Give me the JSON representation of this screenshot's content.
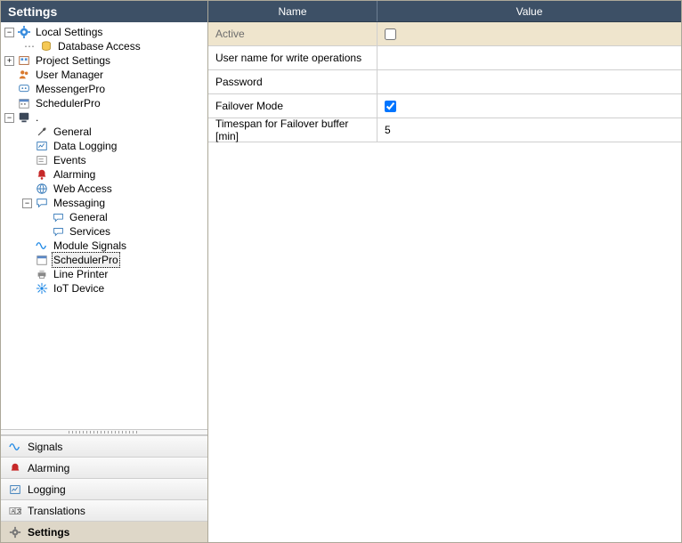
{
  "header": {
    "title": "Settings"
  },
  "tree": {
    "local_settings": "Local Settings",
    "database_access": "Database Access",
    "project_settings": "Project Settings",
    "user_manager": "User Manager",
    "messenger_pro": "MessengerPro",
    "scheduler_pro_top": "SchedulerPro",
    "dot_node": ".",
    "general": "General",
    "data_logging": "Data Logging",
    "events": "Events",
    "alarming": "Alarming",
    "web_access": "Web Access",
    "messaging": "Messaging",
    "messaging_general": "General",
    "messaging_services": "Services",
    "module_signals": "Module Signals",
    "scheduler_pro_sel": "SchedulerPro",
    "line_printer": "Line Printer",
    "iot_device": "IoT Device"
  },
  "nav": {
    "signals": "Signals",
    "alarming": "Alarming",
    "logging": "Logging",
    "translations": "Translations",
    "settings": "Settings"
  },
  "grid": {
    "header_name": "Name",
    "header_value": "Value",
    "rows": {
      "active": {
        "name": "Active",
        "checked": false
      },
      "user_write": {
        "name": "User name for write operations",
        "value": ""
      },
      "password": {
        "name": "Password",
        "value": ""
      },
      "failover_mode": {
        "name": "Failover Mode",
        "checked": true
      },
      "timespan": {
        "name": "Timespan for Failover buffer [min]",
        "value": "5"
      }
    }
  }
}
